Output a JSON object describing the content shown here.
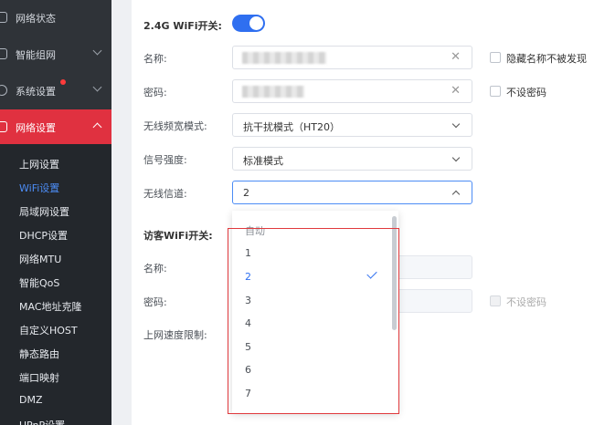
{
  "sidebar": {
    "items": [
      {
        "label": "网络状态"
      },
      {
        "label": "智能组网"
      },
      {
        "label": "系统设置"
      },
      {
        "label": "网络设置"
      }
    ],
    "submenu": [
      {
        "label": "上网设置"
      },
      {
        "label": "WiFi设置"
      },
      {
        "label": "局域网设置"
      },
      {
        "label": "DHCP设置"
      },
      {
        "label": "网络MTU"
      },
      {
        "label": "智能QoS"
      },
      {
        "label": "MAC地址克隆"
      },
      {
        "label": "自定义HOST"
      },
      {
        "label": "静态路由"
      },
      {
        "label": "端口映射"
      },
      {
        "label": "DMZ"
      },
      {
        "label": "UPnP设置"
      }
    ]
  },
  "wifi24": {
    "switch_label": "2.4G WiFi开关:",
    "name_label": "名称:",
    "password_label": "密码:",
    "bandwidth_label": "无线频宽模式:",
    "bandwidth_value": "抗干扰模式（HT20）",
    "signal_label": "信号强度:",
    "signal_value": "标准模式",
    "channel_label": "无线信道:",
    "channel_value": "2",
    "hide_ssid_label": "隐藏名称不被发现",
    "no_password_label": "不设密码"
  },
  "guest": {
    "switch_label": "访客WiFi开关:",
    "name_label": "名称:",
    "password_label": "密码:",
    "speed_label": "上网速度限制:",
    "no_password_label": "不设密码"
  },
  "channel_dropdown": {
    "options": [
      "自动",
      "1",
      "2",
      "3",
      "4",
      "5",
      "6",
      "7"
    ],
    "selected": "2"
  },
  "colors": {
    "accent": "#2f6ff0",
    "active_nav": "#e03140",
    "highlight_box": "#e0393d"
  }
}
